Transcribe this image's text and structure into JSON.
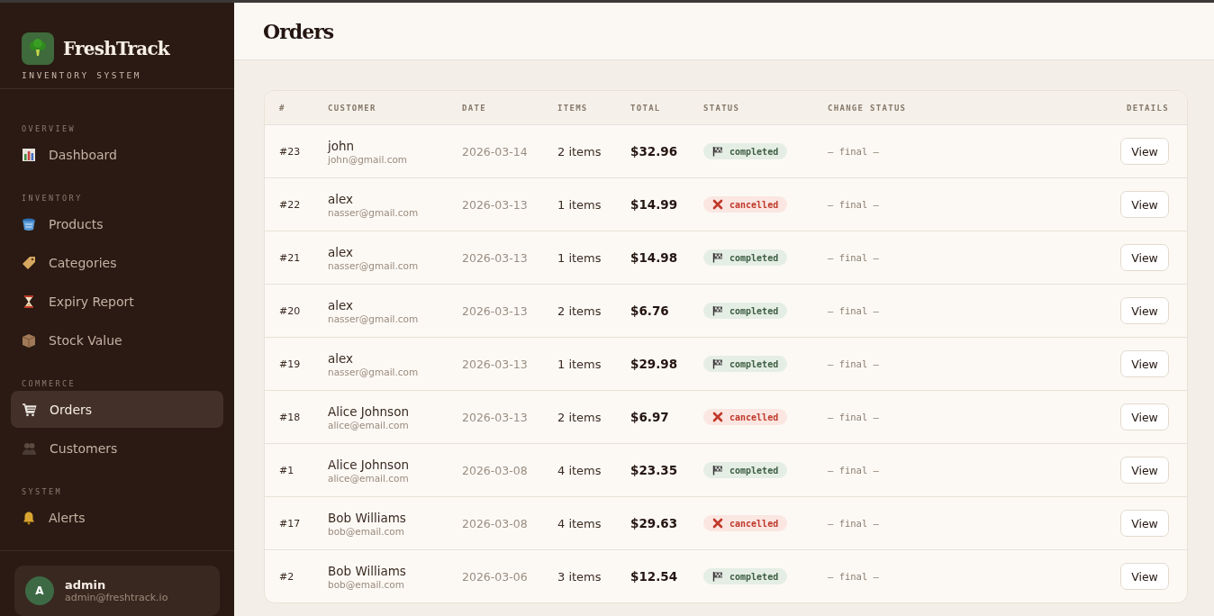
{
  "sidebar": {
    "brand": {
      "name": "FreshTrack",
      "subtitle": "INVENTORY SYSTEM"
    },
    "sections": [
      {
        "label": "OVERVIEW",
        "items": [
          {
            "label": "Dashboard",
            "selected": false
          }
        ]
      },
      {
        "label": "INVENTORY",
        "items": [
          {
            "label": "Products",
            "selected": false
          },
          {
            "label": "Categories",
            "selected": false
          },
          {
            "label": "Expiry Report",
            "selected": false
          },
          {
            "label": "Stock Value",
            "selected": false
          }
        ]
      },
      {
        "label": "COMMERCE",
        "items": [
          {
            "label": "Orders",
            "selected": true
          },
          {
            "label": "Customers",
            "selected": false
          }
        ]
      },
      {
        "label": "SYSTEM",
        "items": [
          {
            "label": "Alerts",
            "selected": false
          }
        ]
      }
    ],
    "user": {
      "initial": "A",
      "name": "admin",
      "email": "admin@freshtrack.io"
    }
  },
  "page": {
    "title": "Orders"
  },
  "table": {
    "columns": [
      "#",
      "CUSTOMER",
      "DATE",
      "ITEMS",
      "TOTAL",
      "STATUS",
      "CHANGE STATUS",
      "DETAILS"
    ],
    "rows": [
      {
        "id": "#23",
        "customer": "john",
        "email": "john@gmail.com",
        "date": "2026-03-14",
        "items": "2 items",
        "total": "$32.96",
        "status": {
          "kind": "completed",
          "label": "completed"
        },
        "change_status": "— final —",
        "action": "View"
      },
      {
        "id": "#22",
        "customer": "alex",
        "email": "nasser@gmail.com",
        "date": "2026-03-13",
        "items": "1 items",
        "total": "$14.99",
        "status": {
          "kind": "cancelled",
          "label": "cancelled"
        },
        "change_status": "— final —",
        "action": "View"
      },
      {
        "id": "#21",
        "customer": "alex",
        "email": "nasser@gmail.com",
        "date": "2026-03-13",
        "items": "1 items",
        "total": "$14.98",
        "status": {
          "kind": "completed",
          "label": "completed"
        },
        "change_status": "— final —",
        "action": "View"
      },
      {
        "id": "#20",
        "customer": "alex",
        "email": "nasser@gmail.com",
        "date": "2026-03-13",
        "items": "2 items",
        "total": "$6.76",
        "status": {
          "kind": "completed",
          "label": "completed"
        },
        "change_status": "— final —",
        "action": "View"
      },
      {
        "id": "#19",
        "customer": "alex",
        "email": "nasser@gmail.com",
        "date": "2026-03-13",
        "items": "1 items",
        "total": "$29.98",
        "status": {
          "kind": "completed",
          "label": "completed"
        },
        "change_status": "— final —",
        "action": "View"
      },
      {
        "id": "#18",
        "customer": "Alice Johnson",
        "email": "alice@email.com",
        "date": "2026-03-13",
        "items": "2 items",
        "total": "$6.97",
        "status": {
          "kind": "cancelled",
          "label": "cancelled"
        },
        "change_status": "— final —",
        "action": "View"
      },
      {
        "id": "#1",
        "customer": "Alice Johnson",
        "email": "alice@email.com",
        "date": "2026-03-08",
        "items": "4 items",
        "total": "$23.35",
        "status": {
          "kind": "completed",
          "label": "completed"
        },
        "change_status": "— final —",
        "action": "View"
      },
      {
        "id": "#17",
        "customer": "Bob Williams",
        "email": "bob@email.com",
        "date": "2026-03-08",
        "items": "4 items",
        "total": "$29.63",
        "status": {
          "kind": "cancelled",
          "label": "cancelled"
        },
        "change_status": "— final —",
        "action": "View"
      },
      {
        "id": "#2",
        "customer": "Bob Williams",
        "email": "bob@email.com",
        "date": "2026-03-06",
        "items": "3 items",
        "total": "$12.54",
        "status": {
          "kind": "completed",
          "label": "completed"
        },
        "change_status": "— final —",
        "action": "View"
      }
    ]
  }
}
